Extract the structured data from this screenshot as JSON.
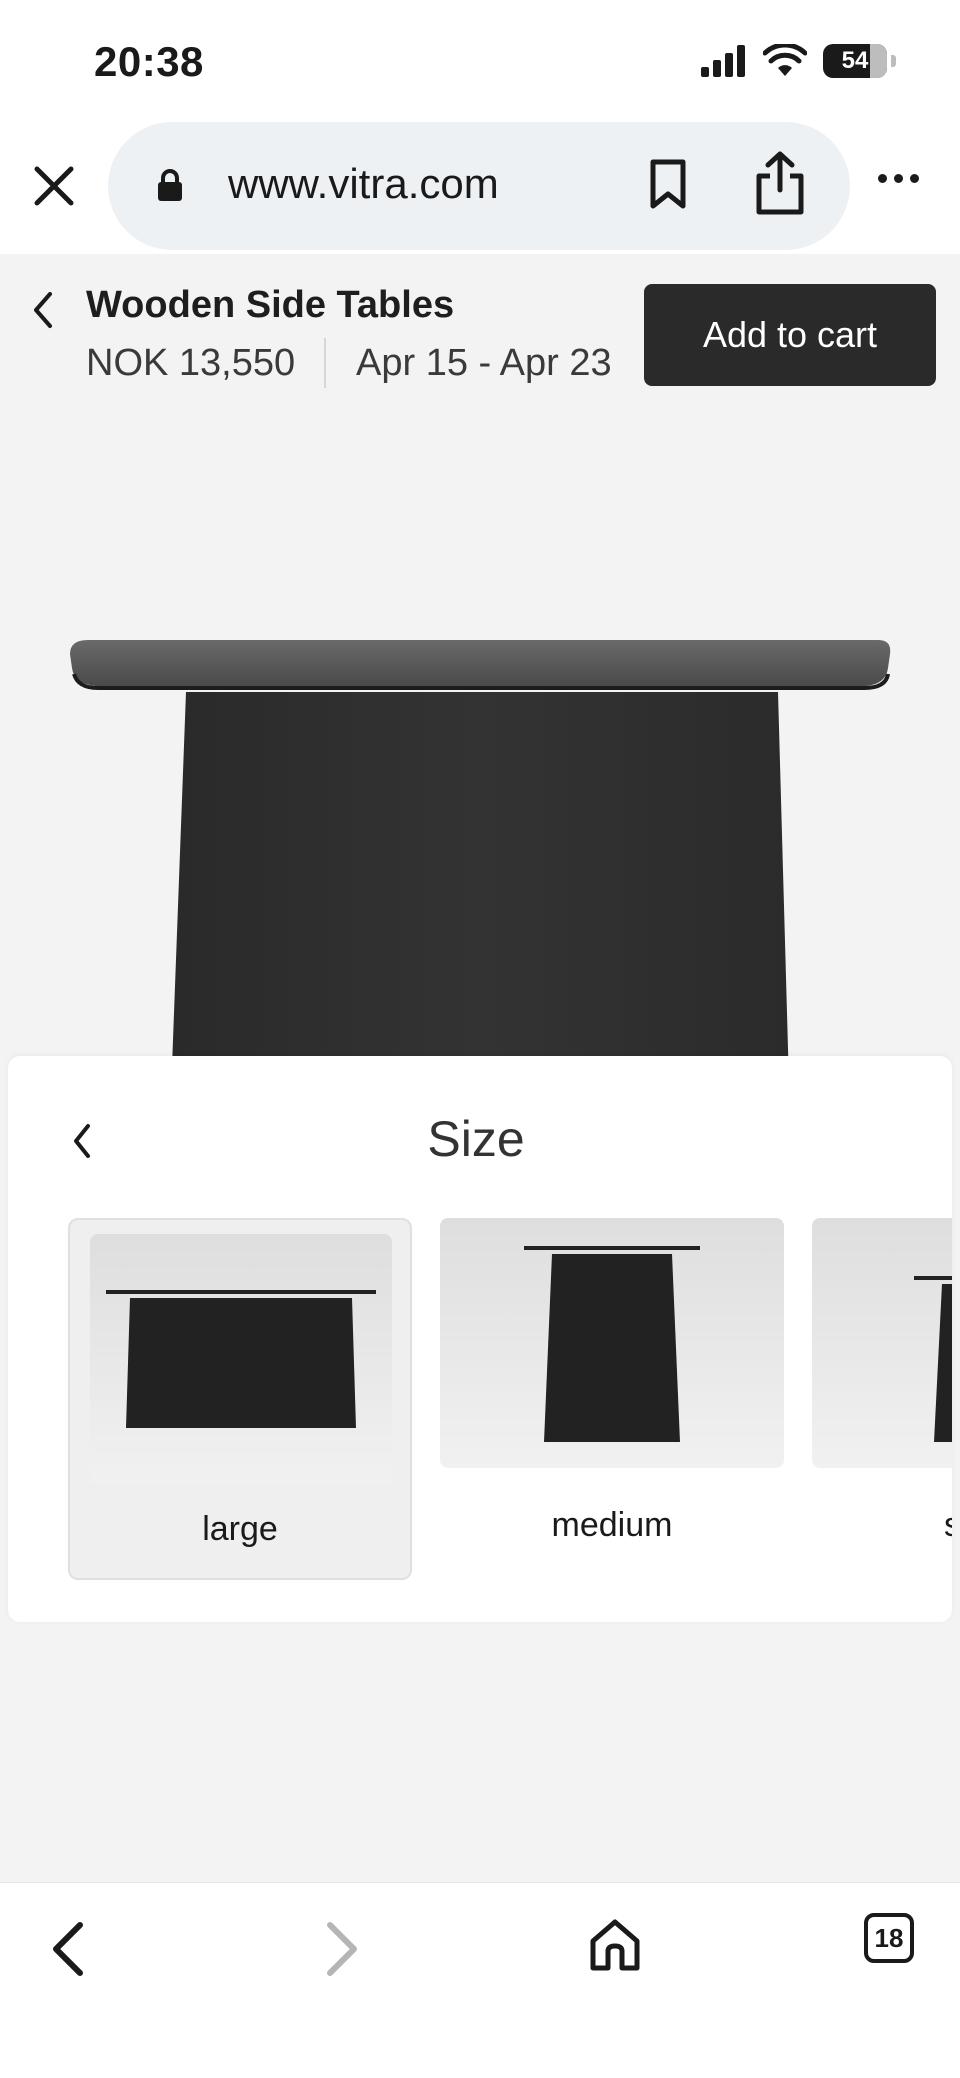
{
  "status_bar": {
    "time": "20:38",
    "battery": "54"
  },
  "browser": {
    "url": "www.vitra.com",
    "tab_count": "18"
  },
  "product": {
    "title": "Wooden Side Tables",
    "price": "NOK 13,550",
    "delivery": "Apr 15 - Apr 23",
    "add_to_cart_label": "Add to cart"
  },
  "size_selector": {
    "title": "Size",
    "options": [
      {
        "label": "large",
        "selected": true
      },
      {
        "label": "medium",
        "selected": false
      },
      {
        "label": "s",
        "selected": false
      }
    ]
  },
  "colors": {
    "accent": "#2a2a2a",
    "page_bg": "#f3f3f3",
    "pill_bg": "#eef1f4"
  }
}
